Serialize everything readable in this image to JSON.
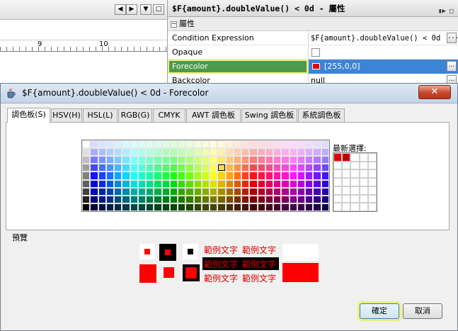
{
  "editor": {
    "ruler_numbers": [
      "9",
      "10"
    ],
    "nav_buttons": [
      "◀",
      "▶",
      "▼",
      "□"
    ]
  },
  "props_panel": {
    "title": "$F{amount}.doubleValue() < 0d - 屬性",
    "section": "屬性",
    "rows": [
      {
        "name": "Condition Expression",
        "value": "$F{amount}.doubleValue() < 0d"
      },
      {
        "name": "Opaque",
        "value": ""
      },
      {
        "name": "Forecolor",
        "value": "[255,0,0]"
      },
      {
        "name": "Backcolor",
        "value": "null"
      }
    ],
    "ellipsis": "..."
  },
  "dialog": {
    "title": "$F{amount}.doubleValue() < 0d - Forecolor",
    "close": "✕",
    "tabs": [
      "調色板(S)",
      "HSV(H)",
      "HSL(L)",
      "RGB(G)",
      "CMYK",
      "AWT 調色板",
      "Swing 調色板",
      "系統調色板"
    ],
    "active_tab": 0,
    "recent_label": "最新選擇:",
    "preview_label": "預覽",
    "sample_text": "範例文字",
    "ok": "確定",
    "cancel": "取消"
  },
  "colors": {
    "selected": "#ff0000",
    "recent": [
      "#e00000",
      "#c00000"
    ],
    "highlight": "#eef07a"
  }
}
